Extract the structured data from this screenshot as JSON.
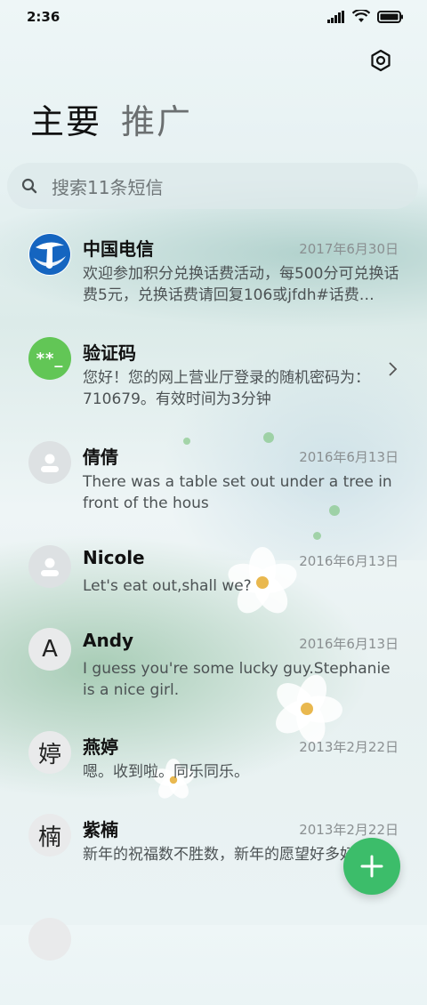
{
  "status_bar": {
    "time": "2:36"
  },
  "tabs": [
    {
      "label": "主要",
      "active": true
    },
    {
      "label": "推广",
      "active": false
    }
  ],
  "search": {
    "placeholder": "搜索11条短信"
  },
  "conversations": [
    {
      "name": "中国电信",
      "date": "2017年6月30日",
      "preview": "欢迎参加积分兑换话费活动，每500分可兑换话费5元，兑换话费请回复106或jfdh#话费…",
      "avatar": "telecom-logo"
    },
    {
      "name": "验证码",
      "date": "",
      "preview": "您好！您的网上营业厅登录的随机密码为：710679。有效时间为3分钟",
      "avatar_text": "**_"
    },
    {
      "name": "倩倩",
      "date": "2016年6月13日",
      "preview": "There was a table set out under a tree in front of the hous",
      "avatar": "person-placeholder"
    },
    {
      "name": "Nicole",
      "date": "2016年6月13日",
      "preview": "Let's eat out,shall we?",
      "avatar": "person-placeholder"
    },
    {
      "name": "Andy",
      "date": "2016年6月13日",
      "preview": "I guess you're some lucky guy.Stephanie is a nice girl.",
      "avatar_text": "A"
    },
    {
      "name": "燕婷",
      "date": "2013年2月22日",
      "preview": "嗯。收到啦。同乐同乐。",
      "avatar_text": "婷"
    },
    {
      "name": "紫楠",
      "date": "2013年2月22日",
      "preview": "新年的祝福数不胜数，新年的愿望好多好多，新年的问候依旧美好，在这个温馨的时刻…",
      "avatar_text": "楠"
    }
  ],
  "colors": {
    "fab": "#3cbd6a",
    "verify_avatar": "#62c656",
    "telecom_blue": "#1565c0"
  },
  "icons": {
    "settings": "hexagon-settings-icon",
    "search": "search-icon",
    "fab": "plus-icon"
  }
}
